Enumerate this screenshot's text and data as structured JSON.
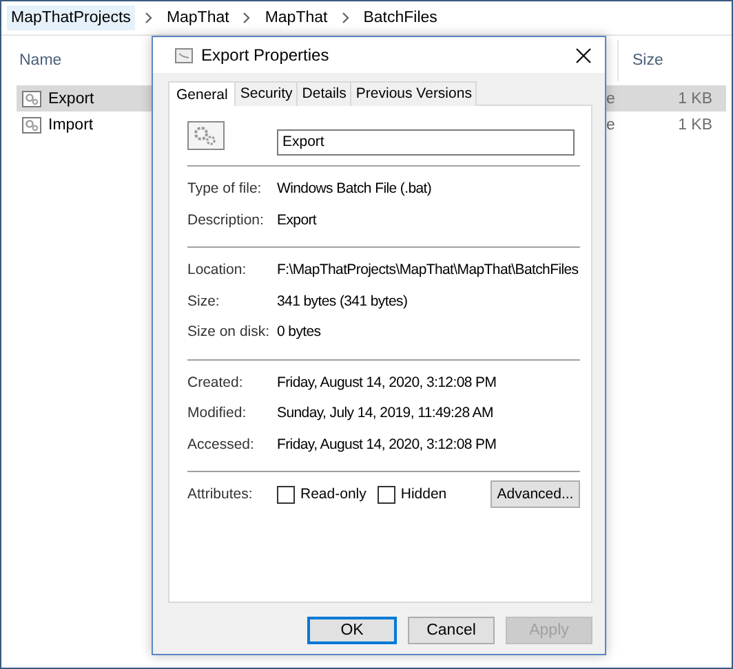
{
  "explorer": {
    "breadcrumb": [
      {
        "label": "MapThatProjects",
        "selected": true
      },
      {
        "label": "MapThat",
        "selected": false
      },
      {
        "label": "MapThat",
        "selected": false
      },
      {
        "label": "BatchFiles",
        "selected": false
      }
    ],
    "columns": {
      "name": "Name",
      "size": "Size"
    },
    "rows": [
      {
        "name": "Export",
        "column_3": "e",
        "size": "1 KB",
        "selected": true
      },
      {
        "name": "Import",
        "column_3": "e",
        "size": "1 KB",
        "selected": false
      }
    ]
  },
  "dialog": {
    "title": "Export Properties",
    "tabs": [
      {
        "label": "General",
        "selected": true
      },
      {
        "label": "Security",
        "selected": false
      },
      {
        "label": "Details",
        "selected": false
      },
      {
        "label": "Previous Versions",
        "selected": false
      }
    ],
    "file_name": "Export",
    "sections": [
      [
        {
          "label": "Type of file:",
          "value": "Windows Batch File (.bat)"
        },
        {
          "label": "Description:",
          "value": "Export"
        }
      ],
      [
        {
          "label": "Location:",
          "value": "F:\\MapThatProjects\\MapThat\\MapThat\\BatchFiles"
        },
        {
          "label": "Size:",
          "value": "341 bytes (341 bytes)"
        },
        {
          "label": "Size on disk:",
          "value": "0 bytes"
        }
      ],
      [
        {
          "label": "Created:",
          "value": "Friday, August 14, 2020, 3:12:08 PM"
        },
        {
          "label": "Modified:",
          "value": "Sunday, July 14, 2019, 11:49:28 AM"
        },
        {
          "label": "Accessed:",
          "value": "Friday, August 14, 2020, 3:12:08 PM"
        }
      ]
    ],
    "attributes": {
      "label": "Attributes:",
      "options": [
        {
          "label": "Read-only",
          "checked": false
        },
        {
          "label": "Hidden",
          "checked": false
        }
      ],
      "advanced_button": "Advanced..."
    },
    "buttons": [
      {
        "label": "OK",
        "kind": "default",
        "disabled": false
      },
      {
        "label": "Cancel",
        "kind": "normal",
        "disabled": false
      },
      {
        "label": "Apply",
        "kind": "normal",
        "disabled": true
      }
    ]
  }
}
